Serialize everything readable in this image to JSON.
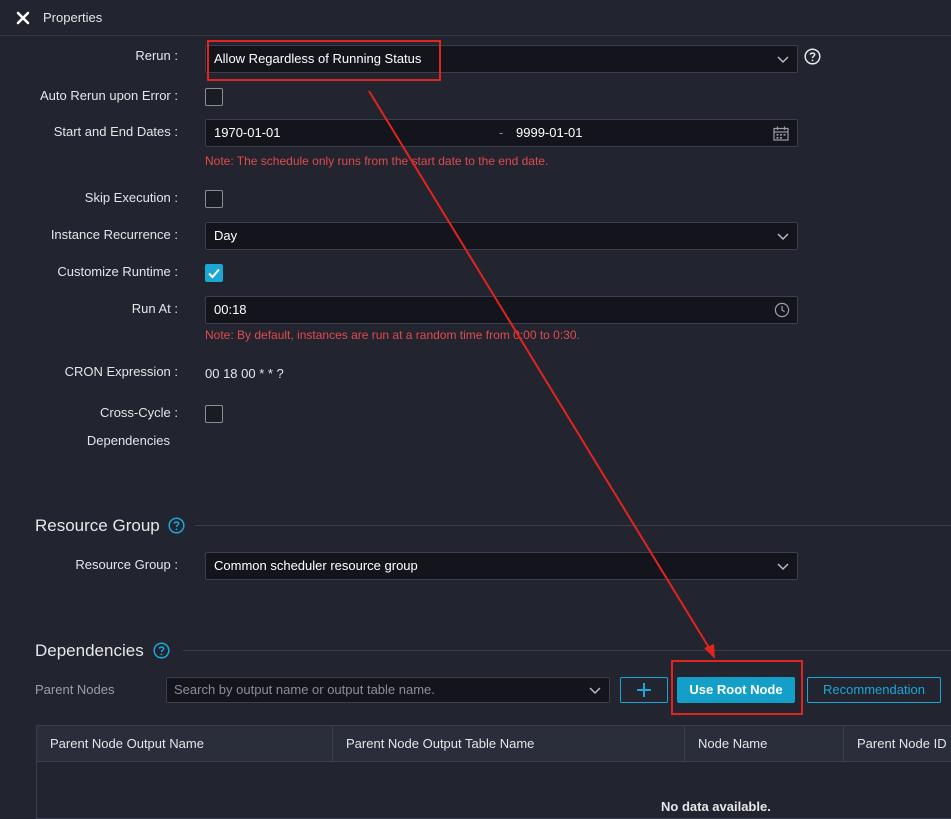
{
  "header": {
    "title": "Properties"
  },
  "form": {
    "rerun": {
      "label": "Rerun :",
      "value": "Allow Regardless of Running Status"
    },
    "auto_rerun": {
      "label": "Auto Rerun upon Error :",
      "checked": false
    },
    "dates": {
      "label": "Start and End Dates :",
      "start": "1970-01-01",
      "separator": "-",
      "end": "9999-01-01",
      "note": "Note: The schedule only runs from the start date to the end date."
    },
    "skip_execution": {
      "label": "Skip Execution :",
      "checked": false
    },
    "instance_recurrence": {
      "label": "Instance Recurrence :",
      "value": "Day"
    },
    "customize_runtime": {
      "label": "Customize Runtime :",
      "checked": true
    },
    "run_at": {
      "label": "Run At :",
      "value": "00:18",
      "note": "Note: By default, instances are run at a random time from 0:00 to 0:30."
    },
    "cron": {
      "label": "CRON Expression :",
      "value": "00 18 00 * * ?"
    },
    "cross_cycle": {
      "label_line1": "Cross-Cycle :",
      "label_line2": "Dependencies",
      "checked": false
    }
  },
  "resource_group": {
    "section_title": "Resource Group",
    "label": "Resource Group :",
    "value": "Common scheduler resource group"
  },
  "dependencies": {
    "section_title": "Dependencies",
    "parent_nodes_label": "Parent Nodes",
    "search_placeholder": "Search by output name or output table name.",
    "add_button": "+",
    "use_root_node_button": "Use Root Node",
    "recommendation_button": "Recommendation",
    "table": {
      "columns": [
        "Parent Node Output Name",
        "Parent Node Output Table Name",
        "Node Name",
        "Parent Node ID"
      ],
      "rows": [],
      "empty_text": "No data available."
    }
  },
  "colors": {
    "background": "#22242f",
    "input_bg": "#14151c",
    "accent": "#1aa7d6",
    "note_red": "#e04b4b",
    "annotation_red": "#e0241f"
  }
}
